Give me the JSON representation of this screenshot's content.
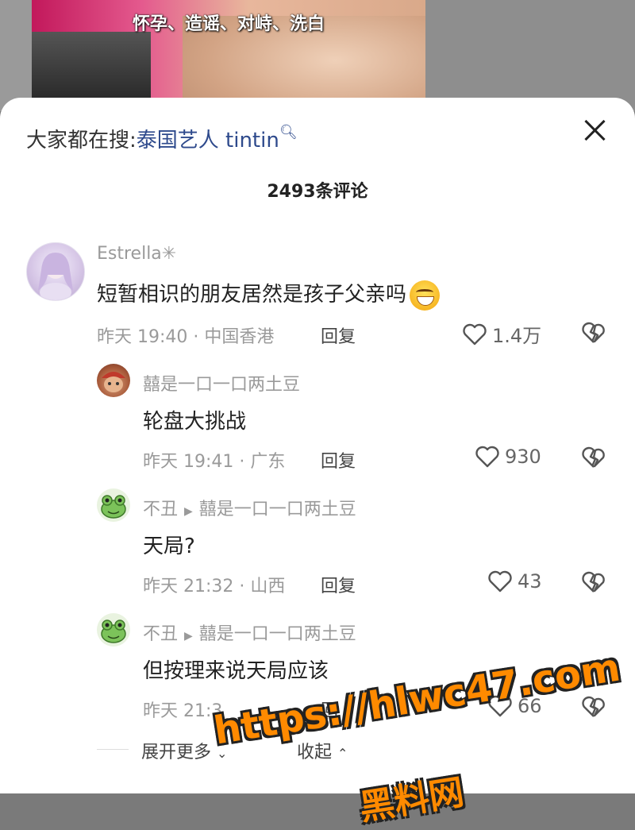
{
  "video": {
    "caption": "怀孕、造谣、对峙、洗白"
  },
  "sheet": {
    "search_prefix": "大家都在搜:",
    "search_keyword": "泰国艺人 tintin",
    "comment_count": "2493条评论"
  },
  "comments": [
    {
      "author": "Estrella✳",
      "text": "短暂相识的朋友居然是孩子父亲吗",
      "meta": "昨天 19:40 · 中国香港",
      "reply": "回复",
      "likes": "1.4万"
    },
    {
      "author": "囍是一口一口两土豆",
      "text": "轮盘大挑战",
      "meta": "昨天 19:41 · 广东",
      "reply": "回复",
      "likes": "930"
    },
    {
      "author": "不丑",
      "reply_to": "囍是一口一口两土豆",
      "text": "天局?",
      "meta": "昨天 21:32 · 山西",
      "reply": "回复",
      "likes": "43"
    },
    {
      "author": "不丑",
      "reply_to": "囍是一口一口两土豆",
      "text": "但按理来说天局应该",
      "meta": "昨天 21:3",
      "reply": "回",
      "likes": "66"
    }
  ],
  "footer": {
    "expand": "展开更多",
    "collapse": "收起"
  },
  "watermark": {
    "line1": "https://hlwc47.com",
    "line2": "黑料网"
  },
  "colors": {
    "keyword": "#2e4a8c",
    "watermark": "#ff8a00",
    "muted": "#9a9a9a"
  }
}
